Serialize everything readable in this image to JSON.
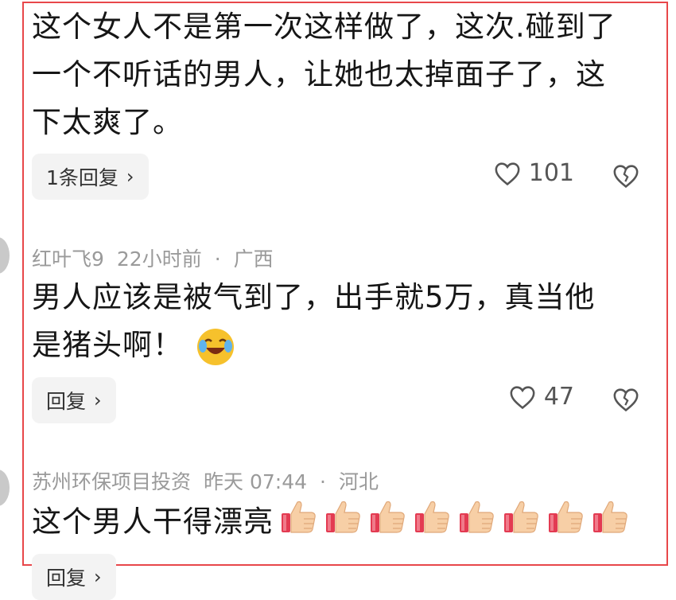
{
  "comments": [
    {
      "lines": [
        "这个女人不是第一次这样做了，这次.碰到了",
        "一个不听话的男人，让她也太掉面子了，这",
        "下太爽了。"
      ],
      "reply_label": "1条回复",
      "likes": "101"
    },
    {
      "user": "红叶飞9",
      "time": "22小时前",
      "separator": "·",
      "region": "广西",
      "lines": [
        "男人应该是被气到了，出手就5万，真当他",
        "是猪头啊！"
      ],
      "emoji": "laughing-emoji",
      "reply_label": "回复",
      "likes": "47"
    },
    {
      "user": "苏州环保项目投资",
      "time": "昨天 07:44",
      "separator": "·",
      "region": "河北",
      "lines": [
        "这个男人干得漂亮"
      ],
      "emoji": "thumbs-up-emoji",
      "emoji_count": 8,
      "reply_label": "回复"
    }
  ],
  "icons": {
    "like": "heart-icon",
    "dislike": "broken-heart-icon",
    "chevron": "chevron-right-icon"
  },
  "colors": {
    "highlight_border": "#e8474a",
    "meta_text": "#9a9a9a",
    "reply_bg": "#f3f3f3"
  }
}
